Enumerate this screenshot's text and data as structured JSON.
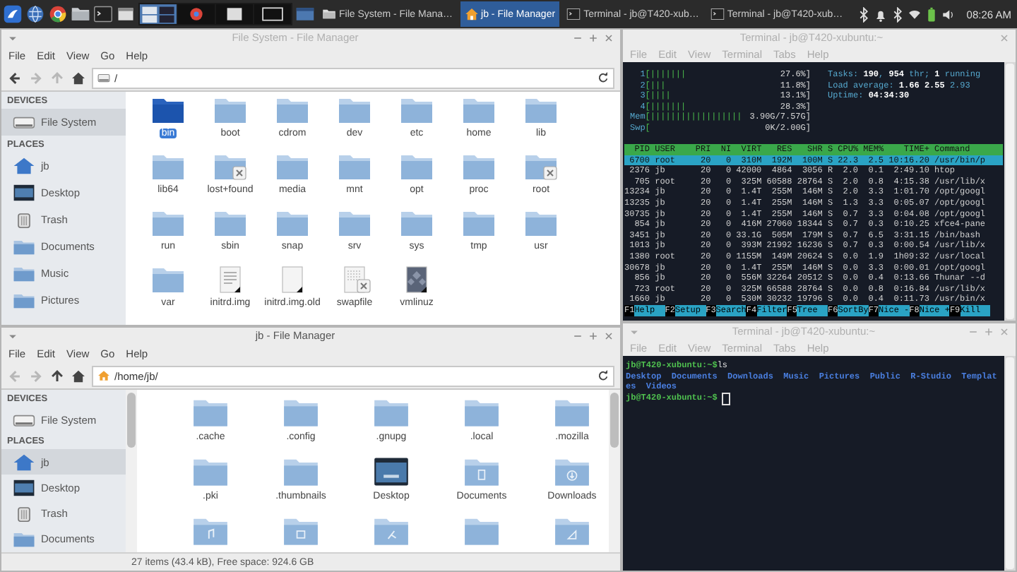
{
  "taskbar": {
    "tasks": [
      {
        "label": "File System - File Mana…",
        "kind": "folder",
        "selected": false
      },
      {
        "label": "jb - File Manager",
        "kind": "home",
        "selected": true
      },
      {
        "label": "Terminal - jb@T420-xub…",
        "kind": "terminal",
        "selected": false
      },
      {
        "label": "Terminal - jb@T420-xub…",
        "kind": "terminal",
        "selected": false
      }
    ],
    "clock": "08:26 AM"
  },
  "file_system_window": {
    "title": "File System - File Manager",
    "active": false,
    "menu": [
      "File",
      "Edit",
      "View",
      "Go",
      "Help"
    ],
    "nav": [
      {
        "kind": "back",
        "disabled": false
      },
      {
        "kind": "forward",
        "disabled": true
      },
      {
        "kind": "up",
        "disabled": true
      },
      {
        "kind": "home",
        "disabled": false
      }
    ],
    "path": {
      "text": "/",
      "kind": "drive"
    },
    "sidebar": [
      {
        "heading": "DEVICES",
        "items": [
          {
            "label": "File System",
            "kind": "drive",
            "selected": true
          }
        ]
      },
      {
        "heading": "PLACES",
        "items": [
          {
            "label": "jb",
            "kind": "home",
            "selected": false
          },
          {
            "label": "Desktop",
            "kind": "desktop",
            "selected": false
          },
          {
            "label": "Trash",
            "kind": "trash",
            "selected": false
          },
          {
            "label": "Documents",
            "kind": "documents",
            "selected": false
          },
          {
            "label": "Music",
            "kind": "music",
            "selected": false
          },
          {
            "label": "Pictures",
            "kind": "pictures",
            "selected": false
          }
        ]
      }
    ],
    "items": [
      {
        "name": "bin",
        "kind": "folder",
        "selected": true
      },
      {
        "name": "boot",
        "kind": "folder",
        "selected": false
      },
      {
        "name": "cdrom",
        "kind": "folder",
        "selected": false
      },
      {
        "name": "dev",
        "kind": "folder",
        "selected": false
      },
      {
        "name": "etc",
        "kind": "folder",
        "selected": false
      },
      {
        "name": "home",
        "kind": "folder",
        "selected": false
      },
      {
        "name": "lib",
        "kind": "folder",
        "selected": false
      },
      {
        "name": "lib64",
        "kind": "folder",
        "selected": false
      },
      {
        "name": "lost+found",
        "kind": "folder-x",
        "selected": false
      },
      {
        "name": "media",
        "kind": "folder",
        "selected": false
      },
      {
        "name": "mnt",
        "kind": "folder",
        "selected": false
      },
      {
        "name": "opt",
        "kind": "folder",
        "selected": false
      },
      {
        "name": "proc",
        "kind": "folder",
        "selected": false
      },
      {
        "name": "root",
        "kind": "folder-x",
        "selected": false
      },
      {
        "name": "run",
        "kind": "folder",
        "selected": false
      },
      {
        "name": "sbin",
        "kind": "folder",
        "selected": false
      },
      {
        "name": "snap",
        "kind": "folder",
        "selected": false
      },
      {
        "name": "srv",
        "kind": "folder",
        "selected": false
      },
      {
        "name": "sys",
        "kind": "folder",
        "selected": false
      },
      {
        "name": "tmp",
        "kind": "folder",
        "selected": false
      },
      {
        "name": "usr",
        "kind": "folder",
        "selected": false
      },
      {
        "name": "var",
        "kind": "folder",
        "selected": false
      },
      {
        "name": "initrd.img",
        "kind": "text-link",
        "selected": false
      },
      {
        "name": "initrd.img.old",
        "kind": "blank-link",
        "selected": false
      },
      {
        "name": "swapfile",
        "kind": "file-x",
        "selected": false
      },
      {
        "name": "vmlinuz",
        "kind": "kernel",
        "selected": false
      }
    ]
  },
  "home_window": {
    "title": "jb - File Manager",
    "active": true,
    "menu": [
      "File",
      "Edit",
      "View",
      "Go",
      "Help"
    ],
    "nav": [
      {
        "kind": "back",
        "disabled": true
      },
      {
        "kind": "forward",
        "disabled": true
      },
      {
        "kind": "up",
        "disabled": false
      },
      {
        "kind": "home",
        "disabled": false
      }
    ],
    "path": {
      "text": "/home/jb/",
      "kind": "home"
    },
    "sidebar": [
      {
        "heading": "DEVICES",
        "items": [
          {
            "label": "File System",
            "kind": "drive",
            "selected": false
          }
        ]
      },
      {
        "heading": "PLACES",
        "items": [
          {
            "label": "jb",
            "kind": "home",
            "selected": true
          },
          {
            "label": "Desktop",
            "kind": "desktop",
            "selected": false
          },
          {
            "label": "Trash",
            "kind": "trash",
            "selected": false
          },
          {
            "label": "Documents",
            "kind": "documents",
            "selected": false
          }
        ]
      }
    ],
    "items": [
      {
        "name": ".cache",
        "kind": "folder",
        "selected": false
      },
      {
        "name": ".config",
        "kind": "folder",
        "selected": false
      },
      {
        "name": ".gnupg",
        "kind": "folder",
        "selected": false
      },
      {
        "name": ".local",
        "kind": "folder",
        "selected": false
      },
      {
        "name": ".mozilla",
        "kind": "folder",
        "selected": false
      },
      {
        "name": ".pki",
        "kind": "folder",
        "selected": false
      },
      {
        "name": ".thumbnails",
        "kind": "folder",
        "selected": false
      },
      {
        "name": "Desktop",
        "kind": "desktop",
        "selected": false
      },
      {
        "name": "Documents",
        "kind": "documents",
        "selected": false
      },
      {
        "name": "Downloads",
        "kind": "downloads",
        "selected": false
      },
      {
        "kind": "music",
        "selected": false
      },
      {
        "kind": "pictures",
        "selected": false
      },
      {
        "kind": "public",
        "selected": false
      },
      {
        "kind": "folder",
        "selected": false
      },
      {
        "kind": "templates",
        "selected": false
      }
    ],
    "status_bar": "27 items (43.4 kB), Free space: 924.6 GB"
  },
  "htop_terminal": {
    "title": "Terminal - jb@T420-xubuntu:~",
    "active": false,
    "menu": [
      "File",
      "Edit",
      "View",
      "Terminal",
      "Tabs",
      "Help"
    ],
    "meters": [
      {
        "label": "1",
        "bar": "[|||||||",
        "reading": "27.6%]"
      },
      {
        "label": "2",
        "bar": "[|||",
        "reading": "11.8%]"
      },
      {
        "label": "3",
        "bar": "[||||",
        "reading": "13.1%]"
      },
      {
        "label": "4",
        "bar": "[|||||||",
        "reading": "28.3%]"
      },
      {
        "label": "Mem",
        "bar": "[||||||||||||||||||",
        "reading": "3.90G/7.57G]"
      },
      {
        "label": "Swp",
        "bar": "[",
        "reading": "0K/2.00G]"
      }
    ],
    "summary": [
      "Tasks: **190**, **954** thr; **1** running",
      "Load average: **1.66** **2.55** 2.93",
      "Uptime: **04:34:30**"
    ],
    "columns": [
      "PID",
      "USER",
      "PRI",
      "NI",
      "VIRT",
      "RES",
      "SHR",
      "S",
      "CPU%",
      "MEM%",
      "TIME+",
      "Command"
    ],
    "processes": [
      {
        "cells": [
          "6700",
          "root",
          "20",
          "0",
          "310M",
          "192M",
          "100M",
          "S",
          "22.3",
          "2.5",
          "10:16.20",
          "/usr/bin/p"
        ],
        "selected": true
      },
      {
        "cells": [
          "2376",
          "jb",
          "20",
          "0",
          "42000",
          "4864",
          "3056",
          "R",
          "2.0",
          "0.1",
          "2:49.10",
          "htop"
        ],
        "selected": false
      },
      {
        "cells": [
          "705",
          "root",
          "20",
          "0",
          "325M",
          "60588",
          "28764",
          "S",
          "2.0",
          "0.8",
          "4:15.38",
          "/usr/lib/x"
        ],
        "selected": false
      },
      {
        "cells": [
          "13234",
          "jb",
          "20",
          "0",
          "1.4T",
          "255M",
          "146M",
          "S",
          "2.0",
          "3.3",
          "1:01.70",
          "/opt/googl"
        ],
        "selected": false
      },
      {
        "cells": [
          "13235",
          "jb",
          "20",
          "0",
          "1.4T",
          "255M",
          "146M",
          "S",
          "1.3",
          "3.3",
          "0:05.07",
          "/opt/googl"
        ],
        "selected": false
      },
      {
        "cells": [
          "30735",
          "jb",
          "20",
          "0",
          "1.4T",
          "255M",
          "146M",
          "S",
          "0.7",
          "3.3",
          "0:04.08",
          "/opt/googl"
        ],
        "selected": false
      },
      {
        "cells": [
          "854",
          "jb",
          "20",
          "0",
          "416M",
          "27060",
          "18344",
          "S",
          "0.7",
          "0.3",
          "0:10.25",
          "xfce4-pane"
        ],
        "selected": false
      },
      {
        "cells": [
          "3451",
          "jb",
          "20",
          "0",
          "33.1G",
          "505M",
          "179M",
          "S",
          "0.7",
          "6.5",
          "3:31.15",
          "/bin/bash"
        ],
        "selected": false
      },
      {
        "cells": [
          "1013",
          "jb",
          "20",
          "0",
          "393M",
          "21992",
          "16236",
          "S",
          "0.7",
          "0.3",
          "0:00.54",
          "/usr/lib/x"
        ],
        "selected": false
      },
      {
        "cells": [
          "1380",
          "root",
          "20",
          "0",
          "1155M",
          "149M",
          "20624",
          "S",
          "0.0",
          "1.9",
          "1h09:32",
          "/usr/local"
        ],
        "selected": false
      },
      {
        "cells": [
          "30678",
          "jb",
          "20",
          "0",
          "1.4T",
          "255M",
          "146M",
          "S",
          "0.0",
          "3.3",
          "0:00.01",
          "/opt/googl"
        ],
        "selected": false
      },
      {
        "cells": [
          "856",
          "jb",
          "20",
          "0",
          "556M",
          "32264",
          "20512",
          "S",
          "0.0",
          "0.4",
          "0:13.66",
          "Thunar --d"
        ],
        "selected": false
      },
      {
        "cells": [
          "723",
          "root",
          "20",
          "0",
          "325M",
          "66588",
          "28764",
          "S",
          "0.0",
          "0.8",
          "0:16.84",
          "/usr/lib/x"
        ],
        "selected": false
      },
      {
        "cells": [
          "1660",
          "jb",
          "20",
          "0",
          "530M",
          "30232",
          "19796",
          "S",
          "0.0",
          "0.4",
          "0:11.73",
          "/usr/bin/x"
        ],
        "selected": false
      }
    ],
    "function_keys": [
      {
        "key": "F1",
        "label": "Help"
      },
      {
        "key": "F2",
        "label": "Setup"
      },
      {
        "key": "F3",
        "label": "Search"
      },
      {
        "key": "F4",
        "label": "Filter"
      },
      {
        "key": "F5",
        "label": "Tree"
      },
      {
        "key": "F6",
        "label": "SortBy"
      },
      {
        "key": "F7",
        "label": "Nice -"
      },
      {
        "key": "F8",
        "label": "Nice +"
      },
      {
        "key": "F9",
        "label": "Kill"
      }
    ]
  },
  "shell_terminal": {
    "title": "Terminal - jb@T420-xubuntu:~",
    "active": false,
    "menu": [
      "File",
      "Edit",
      "View",
      "Terminal",
      "Tabs",
      "Help"
    ],
    "lines": [
      {
        "kind": "prompt",
        "prompt": "jb@T420-xubuntu:~$",
        "command": "ls"
      },
      {
        "kind": "output",
        "text": "Desktop  Documents  Downloads  Music  Pictures  Public  R-Studio  Templates  Videos"
      },
      {
        "kind": "prompt",
        "prompt": "jb@T420-xubuntu:~$",
        "cursor": true
      }
    ]
  }
}
